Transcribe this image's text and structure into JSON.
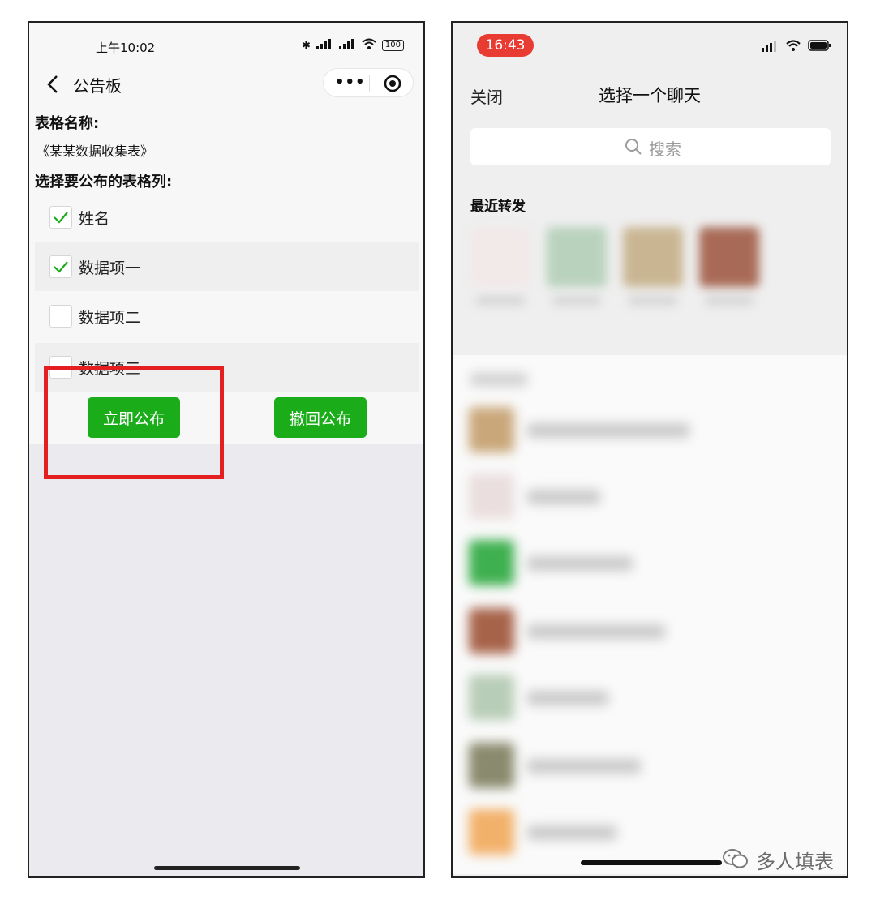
{
  "left_phone": {
    "status_time": "上午10:02",
    "battery": "100",
    "nav_title": "公告板",
    "form_name_label": "表格名称:",
    "form_name": "《某某数据收集表》",
    "columns_label": "选择要公布的表格列:",
    "columns": [
      {
        "label": "姓名",
        "checked": true
      },
      {
        "label": "数据项一",
        "checked": true
      },
      {
        "label": "数据项二",
        "checked": false
      },
      {
        "label": "数据项三",
        "checked": false
      }
    ],
    "publish_button": "立即公布",
    "revoke_button": "撤回公布",
    "accent_color": "#1aad19",
    "highlight_color": "#e41f1f"
  },
  "right_phone": {
    "status_time": "16:43",
    "close_label": "关闭",
    "title": "选择一个聊天",
    "search_placeholder": "搜索",
    "recent_label": "最近转发"
  },
  "watermark": {
    "text": "多人填表"
  }
}
